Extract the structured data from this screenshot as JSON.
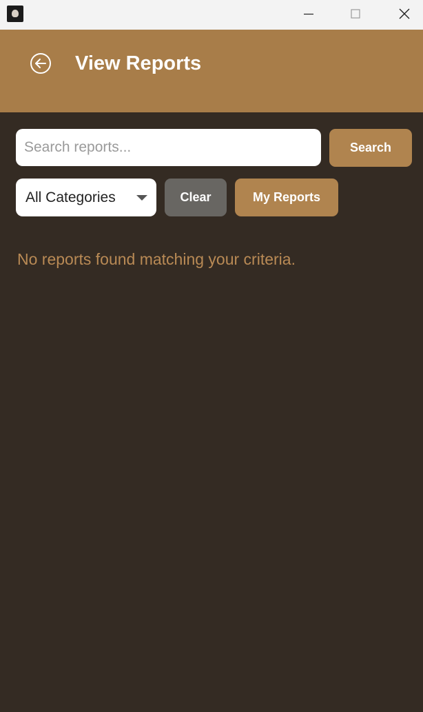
{
  "window": {
    "minimize_icon": "minimize-icon",
    "maximize_icon": "maximize-icon",
    "close_icon": "close-icon"
  },
  "header": {
    "title": "View Reports",
    "back_icon": "arrow-left-circle-icon"
  },
  "search": {
    "placeholder": "Search reports...",
    "value": "",
    "button_label": "Search"
  },
  "filters": {
    "category_selected": "All Categories",
    "clear_label": "Clear",
    "my_reports_label": "My Reports"
  },
  "results": {
    "empty_message": "No reports found matching your criteria."
  },
  "colors": {
    "background": "#342b23",
    "header": "#a87d49",
    "accent_button": "#b0844f",
    "clear_button": "#686662",
    "empty_text": "#b98a55"
  }
}
